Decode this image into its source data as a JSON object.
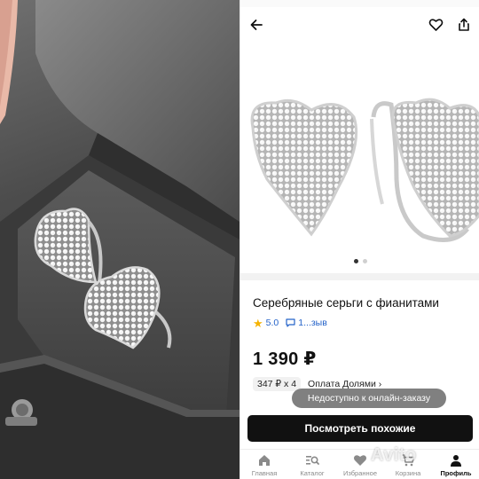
{
  "screen": {
    "product_title": "Серебряные серьги с фианитами",
    "rating": "5.0",
    "reviews": "1...зыв",
    "price": "1 390 ₽",
    "installment": "347 ₽ x 4",
    "installment_link": "Оплата Долями ›",
    "toast": "Недоступно к онлайн-заказу",
    "cta": "Посмотреть похожие",
    "gallery": {
      "pages": 2,
      "active_page": 1
    },
    "tabs": [
      {
        "label": "Главная",
        "icon": "home-icon",
        "active": false
      },
      {
        "label": "Каталог",
        "icon": "catalog-search-icon",
        "active": false
      },
      {
        "label": "Избранное",
        "icon": "heart-icon",
        "active": false
      },
      {
        "label": "Корзина",
        "icon": "cart-icon",
        "active": false
      },
      {
        "label": "Профиль",
        "icon": "profile-icon",
        "active": true
      }
    ]
  },
  "watermark": "Avito",
  "colors": {
    "accent_blue": "#2563c9",
    "star": "#f5b301",
    "cta_bg": "#111111",
    "toast_bg": "#6e6e6e"
  }
}
